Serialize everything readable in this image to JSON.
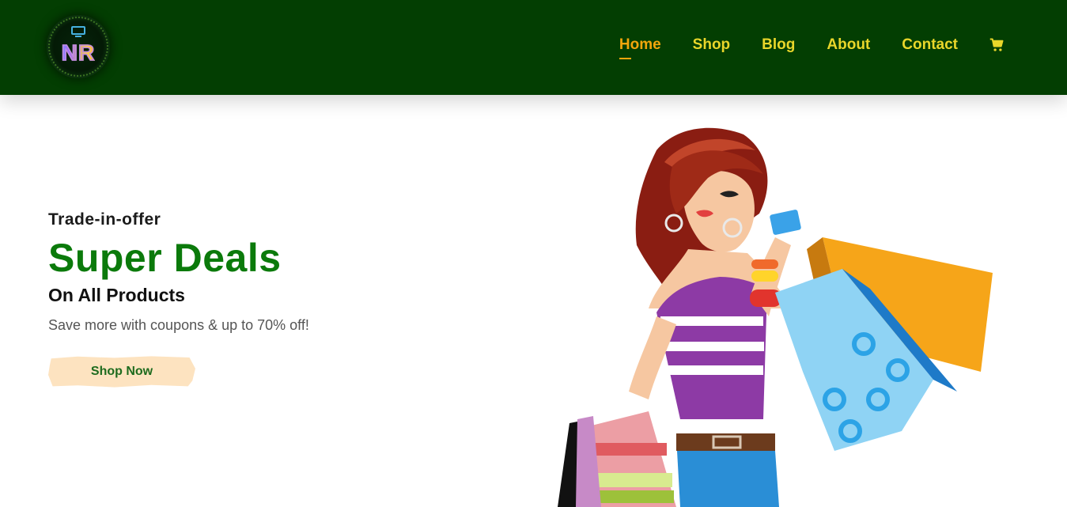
{
  "header": {
    "logo_text": "NR",
    "nav": [
      {
        "label": "Home",
        "active": true
      },
      {
        "label": "Shop",
        "active": false
      },
      {
        "label": "Blog",
        "active": false
      },
      {
        "label": "About",
        "active": false
      },
      {
        "label": "Contact",
        "active": false
      }
    ],
    "cart_icon": "cart-icon",
    "colors": {
      "bg": "#033e02",
      "nav_text": "#e9d62a",
      "active": "#f2a60c"
    }
  },
  "hero": {
    "kicker": "Trade-in-offer",
    "title": "Super Deals",
    "subtitle": "On All Products",
    "description": "Save more with coupons & up to 70% off!",
    "button_label": "Shop Now",
    "colors": {
      "title": "#0b7a0b",
      "button_bg": "#fde3c0",
      "button_text": "#1e6b1e"
    }
  }
}
